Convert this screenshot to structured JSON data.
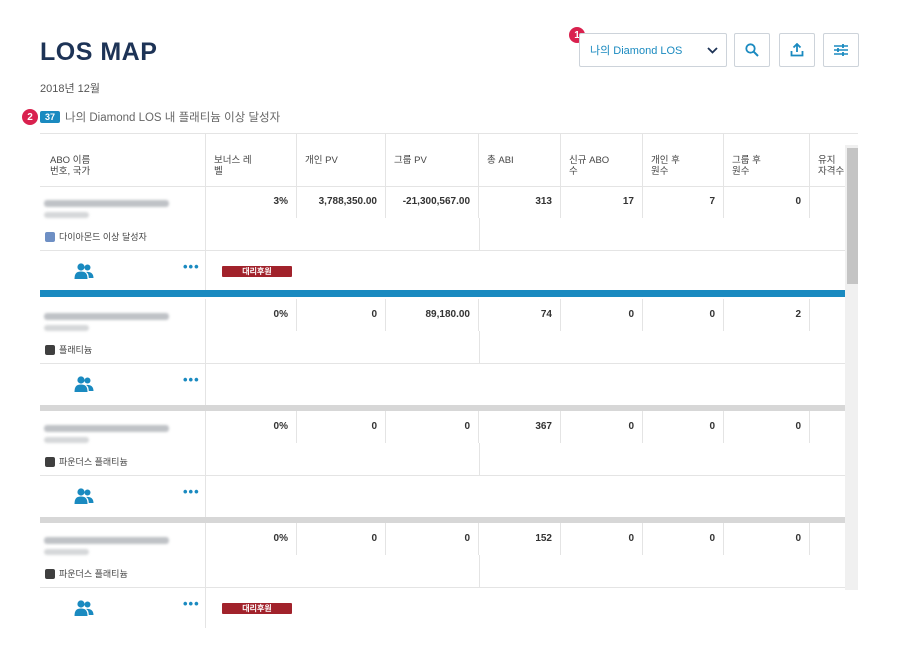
{
  "page": {
    "title": "LOS MAP",
    "date": "2018년 12월"
  },
  "markers": [
    "1",
    "2"
  ],
  "toolbar": {
    "dropdown_value": "나의 Diamond LOS",
    "icons": [
      "search-icon",
      "export-icon",
      "filter-icon"
    ]
  },
  "subtitle": {
    "count": "37",
    "text": "나의 Diamond LOS 내 플래티늄 이상 달성자"
  },
  "table": {
    "headers": [
      "ABO 이름\n번호, 국가",
      "보너스 레\n벨",
      "개인 PV",
      "그룹 PV",
      "총 ABI",
      "신규 ABO\n수",
      "개인 후\n원수",
      "그룹 후\n원수",
      "유지\n자격수"
    ],
    "rows": [
      {
        "level": "다이아몬드 이상 달성자",
        "level_color": "#6e8fc4",
        "values": [
          "3%",
          "3,788,350.00",
          "-21,300,567.00",
          "313",
          "17",
          "7",
          "0"
        ],
        "badge": "대리후원",
        "highlight": true
      },
      {
        "level": "플래티늄",
        "level_color": "#3f3f3f",
        "values": [
          "0%",
          "0",
          "89,180.00",
          "74",
          "0",
          "0",
          "2"
        ],
        "badge": "",
        "highlight": false
      },
      {
        "level": "파운더스 플래티늄",
        "level_color": "#3f3f3f",
        "values": [
          "0%",
          "0",
          "0",
          "367",
          "0",
          "0",
          "0"
        ],
        "badge": "",
        "highlight": false
      },
      {
        "level": "파운더스 플래티늄",
        "level_color": "#3f3f3f",
        "values": [
          "0%",
          "0",
          "0",
          "152",
          "0",
          "0",
          "0"
        ],
        "badge": "대리후원",
        "highlight": false
      }
    ]
  },
  "colors": {
    "accent": "#1a8ac0",
    "title": "#1d3356",
    "marker": "#d9214e",
    "badge": "#a1222b"
  }
}
